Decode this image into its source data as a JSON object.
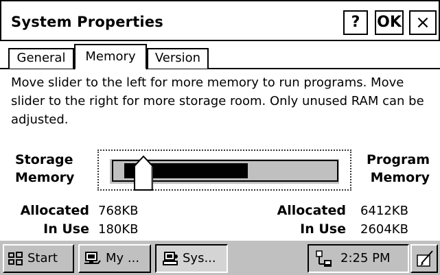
{
  "window": {
    "title": "System Properties",
    "help_label": "?",
    "ok_label": "OK",
    "close_label": "×"
  },
  "tabs": [
    {
      "label": "General",
      "active": false
    },
    {
      "label": "Memory",
      "active": true
    },
    {
      "label": "Version",
      "active": false
    }
  ],
  "memory": {
    "description": "Move slider to the left for more memory to run programs. Move slider to the right for more storage room. Only unused RAM can be adjusted.",
    "storage_label_line1": "Storage",
    "storage_label_line2": "Memory",
    "program_label_line1": "Program",
    "program_label_line2": "Memory",
    "storage": {
      "allocated_label": "Allocated",
      "allocated_value": "768KB",
      "in_use_label": "In Use",
      "in_use_value": "180KB"
    },
    "program": {
      "allocated_label": "Allocated",
      "allocated_value": "6412KB",
      "in_use_label": "In Use",
      "in_use_value": "2604KB"
    },
    "slider_position_fraction": 0.107,
    "fill_fraction": 0.6
  },
  "taskbar": {
    "start_label": "Start",
    "my_label": "My ...",
    "sys_label": "Sys...",
    "clock": "2:25 PM"
  },
  "icons": [
    "windows-flag-icon",
    "my-computer-icon",
    "system-icon",
    "network-tray-icon",
    "keyboard-input-icon"
  ]
}
